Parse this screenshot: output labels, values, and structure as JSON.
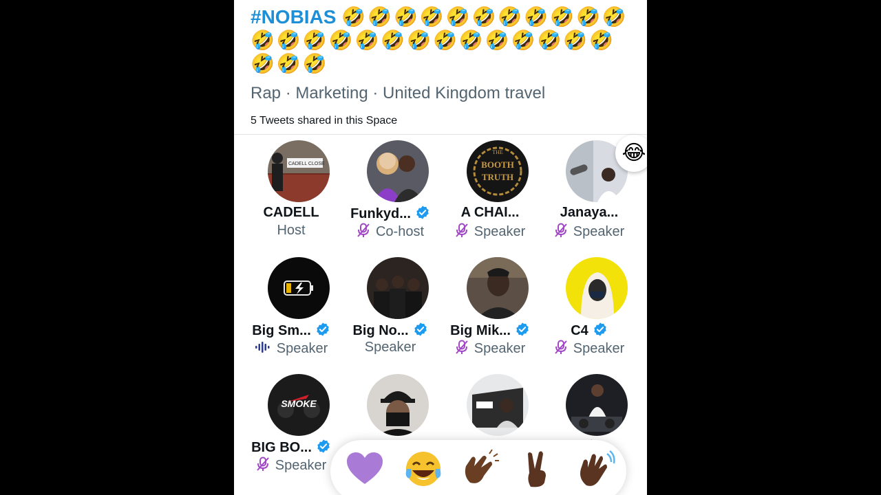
{
  "space": {
    "title_hashtag": "#NOBIAS",
    "title_emojis": "🤣🤣🤣🤣🤣🤣🤣🤣🤣🤣🤣🤣🤣🤣🤣🤣🤣🤣🤣🤣🤣🤣🤣🤣🤣🤣🤣🤣",
    "topics": "Rap · Marketing · United Kingdom travel",
    "tweets_shared": "5 Tweets shared in this Space"
  },
  "participants": [
    {
      "name": "CADELL",
      "role": "Host",
      "verified": false,
      "mic": "none",
      "avatar_icon": "street-sign-photo"
    },
    {
      "name": "Funkyd...",
      "role": "Co-host",
      "verified": true,
      "mic": "muted",
      "avatar_icon": "couple-photo"
    },
    {
      "name": "A CHAI...",
      "role": "Speaker",
      "verified": false,
      "mic": "muted",
      "avatar_icon": "booth-of-truth-logo"
    },
    {
      "name": "Janaya...",
      "role": "Speaker",
      "verified": false,
      "mic": "muted",
      "avatar_icon": "studio-mic-photo",
      "reaction": "😂"
    },
    {
      "name": "Big Sm...",
      "role": "Speaker",
      "verified": true,
      "mic": "speaking",
      "avatar_icon": "battery-icon"
    },
    {
      "name": "Big No...",
      "role": "Speaker",
      "verified": true,
      "mic": "none",
      "avatar_icon": "group-photo"
    },
    {
      "name": "Big Mik...",
      "role": "Speaker",
      "verified": true,
      "mic": "muted",
      "avatar_icon": "man-portrait-photo"
    },
    {
      "name": "C4",
      "role": "Speaker",
      "verified": true,
      "mic": "muted",
      "avatar_icon": "yellow-hoodie-photo"
    },
    {
      "name": "BIG BO...",
      "role": "Speaker",
      "verified": true,
      "mic": "muted",
      "avatar_icon": "smoke-cover-art"
    },
    {
      "name": "",
      "role": "",
      "verified": false,
      "mic": "none",
      "avatar_icon": "masked-man-photo"
    },
    {
      "name": "",
      "role": "",
      "verified": false,
      "mic": "none",
      "avatar_icon": "car-window-photo"
    },
    {
      "name": "",
      "role": "",
      "verified": true,
      "mic": "none",
      "avatar_icon": "dj-photo"
    }
  ],
  "reactions": [
    {
      "icon": "purple-heart-icon",
      "label": "💜"
    },
    {
      "icon": "tears-of-joy-icon",
      "label": "😂"
    },
    {
      "icon": "clapping-hands-icon",
      "label": "👏🏾"
    },
    {
      "icon": "victory-hand-icon",
      "label": "✌🏾"
    },
    {
      "icon": "waving-hand-icon",
      "label": "👋🏾"
    }
  ],
  "colors": {
    "accent": "#1d9bf0",
    "verified": "#1d9bf0",
    "muted_mic": "#a146c6",
    "secondary_text": "#536471",
    "primary_text": "#0f1419",
    "background": "#ffffff"
  }
}
